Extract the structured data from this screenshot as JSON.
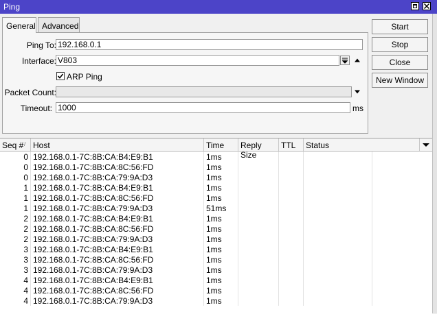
{
  "window": {
    "title": "Ping"
  },
  "tabs": [
    {
      "label": "General",
      "active": true
    },
    {
      "label": "Advanced",
      "active": false
    }
  ],
  "form": {
    "ping_to": {
      "label": "Ping To:",
      "value": "192.168.0.1"
    },
    "interface": {
      "label": "Interface:",
      "value": "V803"
    },
    "arp_ping": {
      "label": "ARP Ping",
      "checked": true
    },
    "packet_count": {
      "label": "Packet Count:",
      "value": ""
    },
    "timeout": {
      "label": "Timeout:",
      "value": "1000",
      "unit": "ms"
    }
  },
  "buttons": {
    "start": "Start",
    "stop": "Stop",
    "close": "Close",
    "new_window": "New Window"
  },
  "table": {
    "columns": [
      "Seq #",
      "Host",
      "Time",
      "Reply Size",
      "TTL",
      "Status"
    ],
    "rows": [
      {
        "seq": "0",
        "host": "192.168.0.1-7C:8B:CA:B4:E9:B1",
        "time": "1ms"
      },
      {
        "seq": "0",
        "host": "192.168.0.1-7C:8B:CA:8C:56:FD",
        "time": "1ms"
      },
      {
        "seq": "0",
        "host": "192.168.0.1-7C:8B:CA:79:9A:D3",
        "time": "1ms"
      },
      {
        "seq": "1",
        "host": "192.168.0.1-7C:8B:CA:B4:E9:B1",
        "time": "1ms"
      },
      {
        "seq": "1",
        "host": "192.168.0.1-7C:8B:CA:8C:56:FD",
        "time": "1ms"
      },
      {
        "seq": "1",
        "host": "192.168.0.1-7C:8B:CA:79:9A:D3",
        "time": "51ms"
      },
      {
        "seq": "2",
        "host": "192.168.0.1-7C:8B:CA:B4:E9:B1",
        "time": "1ms"
      },
      {
        "seq": "2",
        "host": "192.168.0.1-7C:8B:CA:8C:56:FD",
        "time": "1ms"
      },
      {
        "seq": "2",
        "host": "192.168.0.1-7C:8B:CA:79:9A:D3",
        "time": "1ms"
      },
      {
        "seq": "3",
        "host": "192.168.0.1-7C:8B:CA:B4:E9:B1",
        "time": "1ms"
      },
      {
        "seq": "3",
        "host": "192.168.0.1-7C:8B:CA:8C:56:FD",
        "time": "1ms"
      },
      {
        "seq": "3",
        "host": "192.168.0.1-7C:8B:CA:79:9A:D3",
        "time": "1ms"
      },
      {
        "seq": "4",
        "host": "192.168.0.1-7C:8B:CA:B4:E9:B1",
        "time": "1ms"
      },
      {
        "seq": "4",
        "host": "192.168.0.1-7C:8B:CA:8C:56:FD",
        "time": "1ms"
      },
      {
        "seq": "4",
        "host": "192.168.0.1-7C:8B:CA:79:9A:D3",
        "time": "1ms"
      }
    ]
  },
  "colors": {
    "titlebar": "#4c44c8"
  },
  "icons": [
    "maximize-icon",
    "close-icon",
    "dropdown-icon",
    "up-arrow-icon",
    "down-arrow-icon",
    "sort-icon",
    "column-menu-icon",
    "checkmark-icon"
  ]
}
